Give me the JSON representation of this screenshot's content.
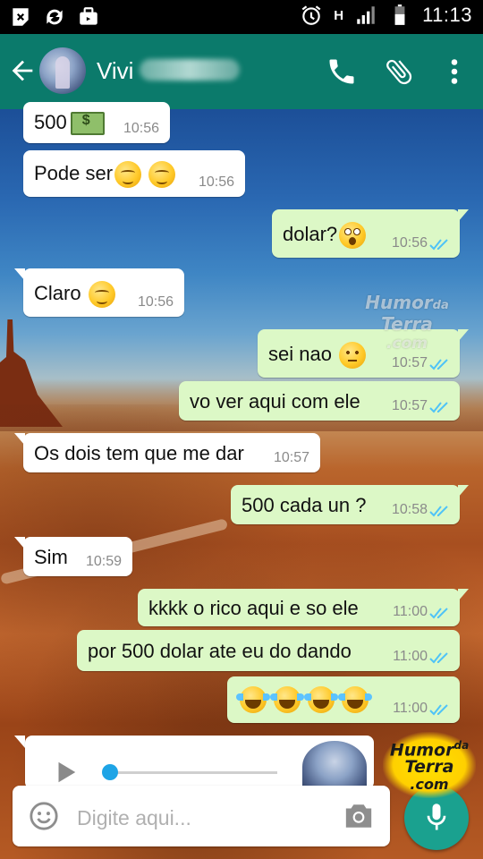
{
  "status_bar": {
    "time": "11:13",
    "network_type": "H",
    "icons": [
      "app-notification-icon",
      "sync-icon",
      "briefcase-icon",
      "alarm-icon",
      "signal-icon",
      "battery-icon"
    ]
  },
  "header": {
    "contact_name": "Vivi",
    "actions": [
      "phone-icon",
      "paperclip-icon",
      "more-vert-icon"
    ]
  },
  "messages": [
    {
      "dir": "in",
      "text": "500",
      "time": "10:56",
      "emojis": [
        "money-with-wings"
      ]
    },
    {
      "dir": "in",
      "text": "Pode ser",
      "time": "10:56",
      "emojis": [
        "smirk",
        "relieved"
      ]
    },
    {
      "dir": "out",
      "text": "dolar?",
      "time": "10:56",
      "emojis": [
        "flushed"
      ],
      "ticks": "read"
    },
    {
      "dir": "in",
      "text": "Claro",
      "time": "10:56",
      "emojis": [
        "relieved"
      ]
    },
    {
      "dir": "out",
      "text": "sei nao",
      "time": "10:57",
      "emojis": [
        "no-mouth"
      ],
      "ticks": "read"
    },
    {
      "dir": "out",
      "text": "vo ver aqui com ele",
      "time": "10:57",
      "ticks": "read"
    },
    {
      "dir": "in",
      "text": "Os dois tem que me dar",
      "time": "10:57"
    },
    {
      "dir": "out",
      "text": "500 cada un ?",
      "time": "10:58",
      "ticks": "read"
    },
    {
      "dir": "in",
      "text": "Sim",
      "time": "10:59"
    },
    {
      "dir": "out",
      "text": "kkkk o rico aqui e so ele",
      "time": "11:00",
      "ticks": "read"
    },
    {
      "dir": "out",
      "text": "por 500 dolar ate eu do dando",
      "time": "11:00",
      "ticks": "read"
    },
    {
      "dir": "out",
      "text": "",
      "time": "11:00",
      "emojis": [
        "joy",
        "joy",
        "joy",
        "joy"
      ],
      "ticks": "read"
    }
  ],
  "audio_message": {
    "dir": "in",
    "progress": 0.0
  },
  "composer": {
    "placeholder": "Digite aqui..."
  },
  "watermark": {
    "line1": "Humor",
    "line1_suffix": "da",
    "line2": "Terra",
    "line3": ".com"
  },
  "colors": {
    "app_bar": "#0b7a6b",
    "outgoing_bubble": "#dcf8c6",
    "incoming_bubble": "#ffffff",
    "read_ticks": "#4fc3f7",
    "mic_button": "#1aa18f"
  }
}
